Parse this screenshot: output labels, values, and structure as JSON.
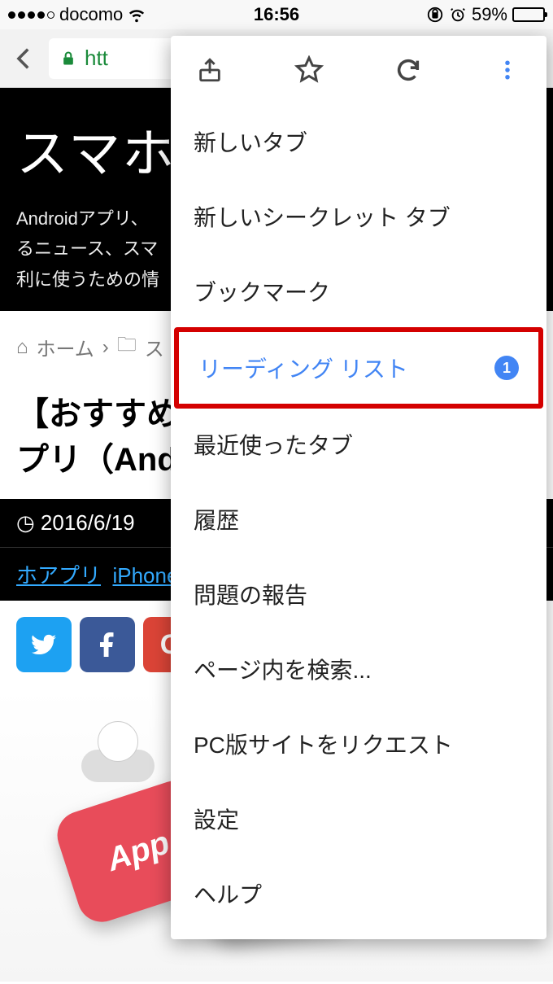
{
  "status": {
    "carrier": "docomo",
    "time": "16:56",
    "battery_pct": "59%"
  },
  "toolbar": {
    "url_fragment": "htt"
  },
  "page": {
    "hero_title": "スマホ",
    "hero_sub": "Androidアプリ、\nるニュース、スマ\n利に使うための情",
    "breadcrumb_home": "ホーム",
    "breadcrumb_cat": "ス",
    "article_title": "【おすすめ\nプリ（And",
    "date": "2016/6/19",
    "link1": "ホアプリ",
    "link_sep": ", ",
    "link2": "iPhone",
    "app_label": "App"
  },
  "menu": {
    "items": [
      {
        "label": "新しいタブ"
      },
      {
        "label": "新しいシークレット タブ"
      },
      {
        "label": "ブックマーク"
      },
      {
        "label": "リーディング リスト",
        "badge": "1",
        "highlighted": true
      },
      {
        "label": "最近使ったタブ"
      },
      {
        "label": "履歴"
      },
      {
        "label": "問題の報告"
      },
      {
        "label": "ページ内を検索..."
      },
      {
        "label": "PC版サイトをリクエスト"
      },
      {
        "label": "設定"
      },
      {
        "label": "ヘルプ"
      }
    ]
  }
}
